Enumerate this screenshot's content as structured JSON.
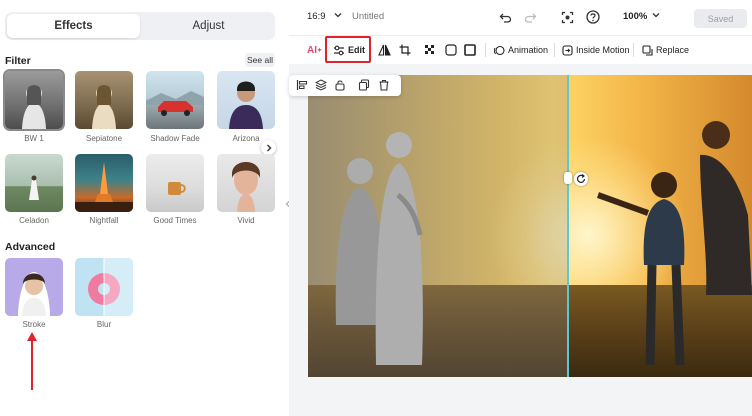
{
  "panel": {
    "tabs": [
      {
        "label": "Effects",
        "active": true
      },
      {
        "label": "Adjust",
        "active": false
      }
    ],
    "filter": {
      "title": "Filter",
      "see_all": "See all",
      "items": [
        {
          "label": "BW 1",
          "selected": true
        },
        {
          "label": "Sepiatone"
        },
        {
          "label": "Shadow Fade"
        },
        {
          "label": "Arizona"
        },
        {
          "label": "Celadon"
        },
        {
          "label": "Nightfall"
        },
        {
          "label": "Good Times"
        },
        {
          "label": "Vivid"
        }
      ]
    },
    "advanced": {
      "title": "Advanced",
      "items": [
        {
          "label": "Stroke"
        },
        {
          "label": "Blur"
        }
      ]
    }
  },
  "topbar": {
    "aspect_ratio": "16:9",
    "doc_title": "Untitled",
    "zoom": "100%",
    "saved_label": "Saved"
  },
  "toolbar": {
    "ai_label": "AI",
    "edit_label": "Edit",
    "animation_label": "Animation",
    "inside_motion_label": "Inside Motion",
    "replace_label": "Replace"
  },
  "colors": {
    "highlight": "#e0232b",
    "split_line": "#5cc8d0",
    "ai_accent": "#e8486b"
  }
}
